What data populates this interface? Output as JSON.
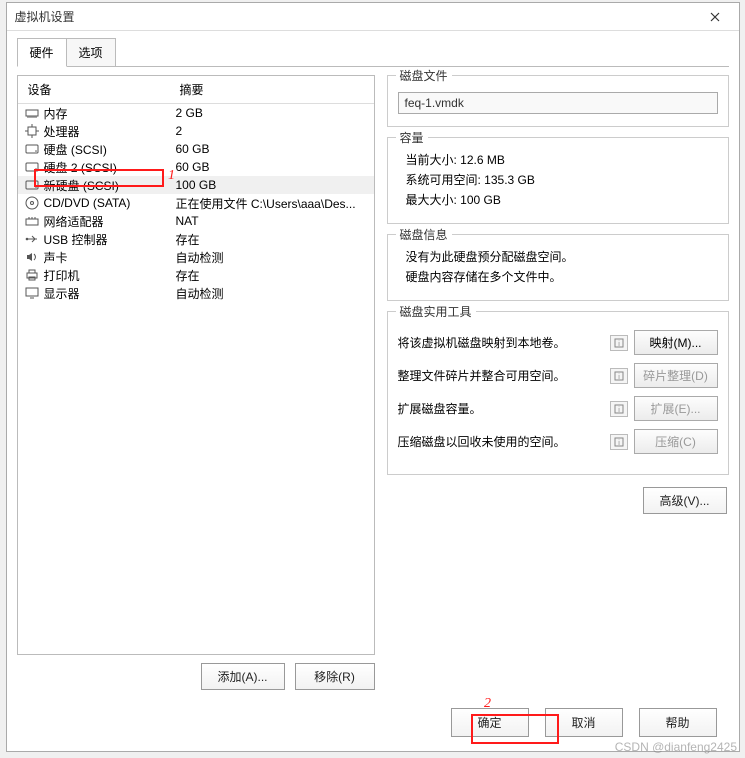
{
  "window": {
    "title": "虚拟机设置"
  },
  "tabs": {
    "active": "硬件",
    "inactive": "选项"
  },
  "table": {
    "header_device": "设备",
    "header_summary": "摘要",
    "rows": [
      {
        "icon": "memory",
        "name": "内存",
        "summary": "2 GB"
      },
      {
        "icon": "cpu",
        "name": "处理器",
        "summary": "2"
      },
      {
        "icon": "disk",
        "name": "硬盘 (SCSI)",
        "summary": "60 GB"
      },
      {
        "icon": "disk",
        "name": "硬盘 2 (SCSI)",
        "summary": "60 GB"
      },
      {
        "icon": "disk",
        "name": "新硬盘 (SCSI)",
        "summary": "100 GB",
        "selected": true
      },
      {
        "icon": "cd",
        "name": "CD/DVD (SATA)",
        "summary": "正在使用文件 C:\\Users\\aaa\\Des..."
      },
      {
        "icon": "net",
        "name": "网络适配器",
        "summary": "NAT"
      },
      {
        "icon": "usb",
        "name": "USB 控制器",
        "summary": "存在"
      },
      {
        "icon": "sound",
        "name": "声卡",
        "summary": "自动检测"
      },
      {
        "icon": "printer",
        "name": "打印机",
        "summary": "存在"
      },
      {
        "icon": "display",
        "name": "显示器",
        "summary": "自动检测"
      }
    ]
  },
  "left_actions": {
    "add": "添加(A)...",
    "remove": "移除(R)"
  },
  "right": {
    "disk_file": {
      "title": "磁盘文件",
      "value": "feq-1.vmdk"
    },
    "capacity": {
      "title": "容量",
      "current": "当前大小: 12.6 MB",
      "avail": "系统可用空间: 135.3 GB",
      "max": "最大大小: 100 GB"
    },
    "diskinfo": {
      "title": "磁盘信息",
      "line1": "没有为此硬盘预分配磁盘空间。",
      "line2": "硬盘内容存储在多个文件中。"
    },
    "utilities": {
      "title": "磁盘实用工具",
      "rows": [
        {
          "text": "将该虚拟机磁盘映射到本地卷。",
          "btn": "映射(M)...",
          "enabled": true
        },
        {
          "text": "整理文件碎片并整合可用空间。",
          "btn": "碎片整理(D)",
          "enabled": false
        },
        {
          "text": "扩展磁盘容量。",
          "btn": "扩展(E)...",
          "enabled": false
        },
        {
          "text": "压缩磁盘以回收未使用的空间。",
          "btn": "压缩(C)",
          "enabled": false
        }
      ]
    },
    "advanced": "高级(V)..."
  },
  "bottom": {
    "ok": "确定",
    "cancel": "取消",
    "help": "帮助"
  },
  "annotations": {
    "a1": "1",
    "a2": "2"
  },
  "watermark": "CSDN @dianfeng2425"
}
